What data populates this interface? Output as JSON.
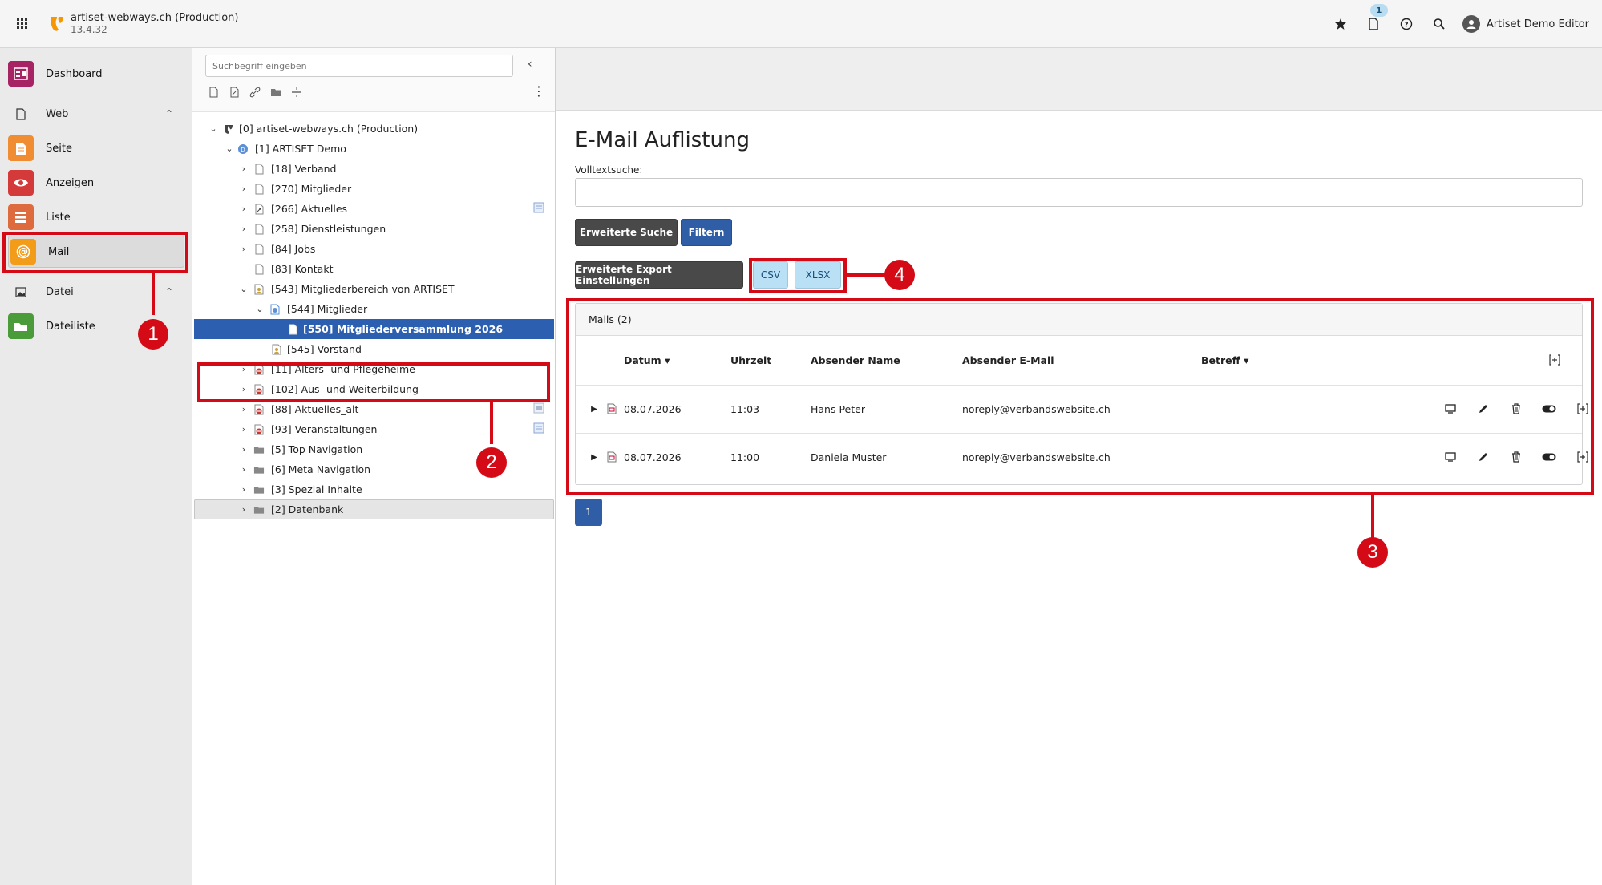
{
  "topbar": {
    "site_name": "artiset-webways.ch (Production)",
    "version": "13.4.32",
    "notification_count": "1",
    "user_name": "Artiset Demo Editor",
    "icons": [
      "apps-grid-icon",
      "typo3-logo-icon",
      "star-icon",
      "document-icon",
      "help-icon",
      "search-icon",
      "user-avatar-icon"
    ]
  },
  "module_menu": {
    "dashboard": "Dashboard",
    "web_group": "Web",
    "seite": "Seite",
    "anzeigen": "Anzeigen",
    "liste": "Liste",
    "mail": "Mail",
    "datei_group": "Datei",
    "dateiliste": "Dateiliste"
  },
  "page_tree": {
    "search_placeholder": "Suchbegriff eingeben",
    "items": [
      {
        "label": "[0] artiset-webways.ch (Production)"
      },
      {
        "label": "[1] ARTISET Demo"
      },
      {
        "label": "[18] Verband"
      },
      {
        "label": "[270] Mitglieder"
      },
      {
        "label": "[266] Aktuelles"
      },
      {
        "label": "[258] Dienstleistungen"
      },
      {
        "label": "[84] Jobs"
      },
      {
        "label": "[83] Kontakt"
      },
      {
        "label": "[543] Mitgliederbereich von ARTISET"
      },
      {
        "label": "[544] Mitglieder"
      },
      {
        "label": "[550] Mitgliederversammlung 2026"
      },
      {
        "label": "[545] Vorstand"
      },
      {
        "label": "[11] Alters- und Pflegeheime"
      },
      {
        "label": "[102] Aus- und Weiterbildung"
      },
      {
        "label": "[88] Aktuelles_alt"
      },
      {
        "label": "[93] Veranstaltungen"
      },
      {
        "label": "[5] Top Navigation"
      },
      {
        "label": "[6] Meta Navigation"
      },
      {
        "label": "[3] Spezial Inhalte"
      },
      {
        "label": "[2] Datenbank"
      }
    ]
  },
  "content": {
    "title": "E-Mail Auflistung",
    "fulltext_label": "Volltextsuche:",
    "btn_advanced_search": "Erweiterte Suche",
    "btn_filter": "Filtern",
    "btn_export_settings": "Erweiterte Export Einstellungen",
    "btn_csv": "CSV",
    "btn_xlsx": "XLSX",
    "panel_title": "Mails (2)",
    "columns": {
      "datum": "Datum",
      "uhrzeit": "Uhrzeit",
      "absender_name": "Absender Name",
      "absender_email": "Absender E-Mail",
      "betreff": "Betreff"
    },
    "rows": [
      {
        "datum": "08.07.2026",
        "uhrzeit": "11:03",
        "name": "Hans Peter",
        "email": "noreply@verbandswebsite.ch",
        "betreff": ""
      },
      {
        "datum": "08.07.2026",
        "uhrzeit": "11:00",
        "name": "Daniela Muster",
        "email": "noreply@verbandswebsite.ch",
        "betreff": ""
      }
    ],
    "page": "1"
  },
  "annotations": {
    "n1": "1",
    "n2": "2",
    "n3": "3",
    "n4": "4"
  },
  "colors": {
    "annotation_red": "#d40b16",
    "primary_blue": "#2f5ea6",
    "selected_blue": "#2c5fb0",
    "export_light_blue": "#b9e0f4",
    "dark_button": "#494949"
  }
}
